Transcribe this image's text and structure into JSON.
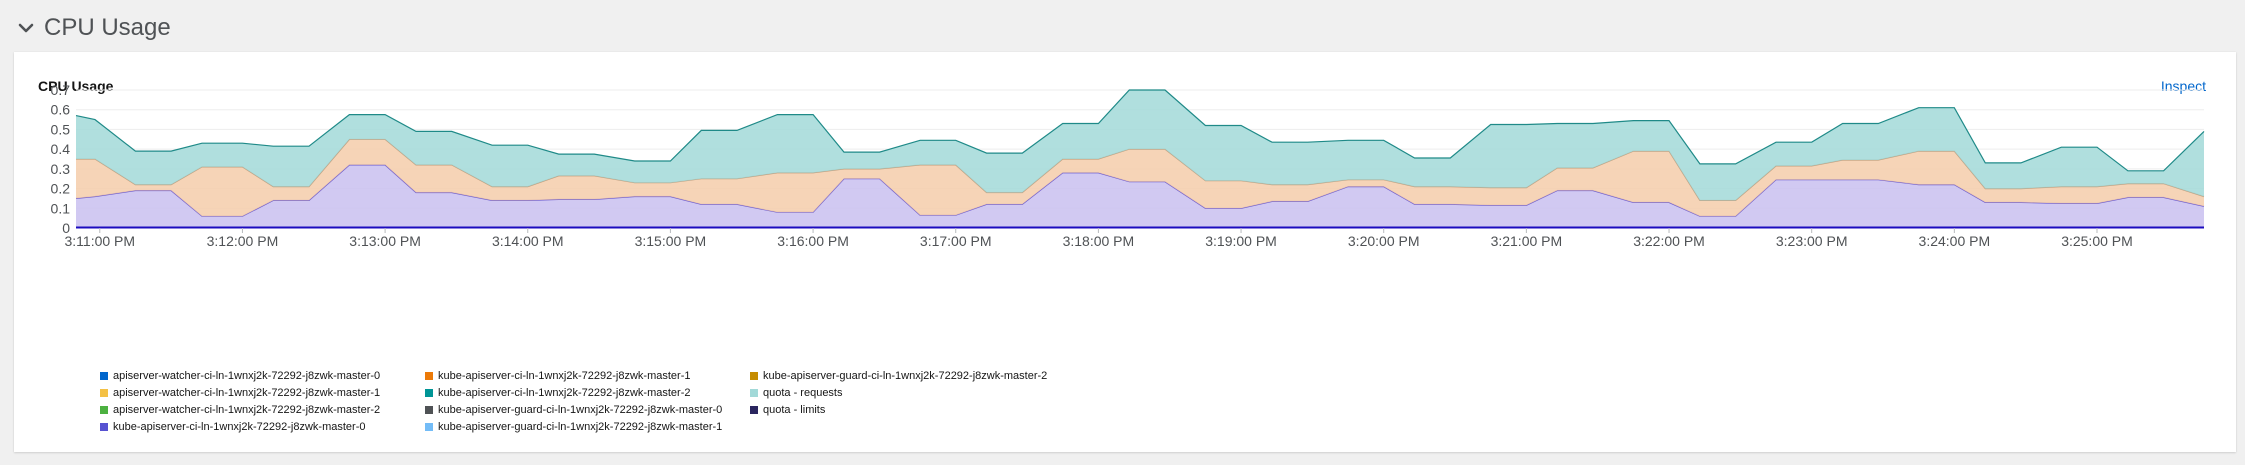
{
  "section": {
    "title": "CPU Usage",
    "icon": "chevron-down-icon"
  },
  "card": {
    "title": "CPU Usage",
    "inspect_label": "Inspect"
  },
  "colors": {
    "link": "#0066cc",
    "line": "#1f8a88",
    "requests_fill": "#a2d9d8",
    "master1_fill": "#f4ccaa",
    "master0_fill": "#c9c0f0",
    "master0_line": "#6b5bcf",
    "limits_line": "#1c0cbf"
  },
  "legend": [
    {
      "label": "apiserver-watcher-ci-ln-1wnxj2k-72292-j8zwk-master-0",
      "color": "#0066cc"
    },
    {
      "label": "kube-apiserver-ci-ln-1wnxj2k-72292-j8zwk-master-1",
      "color": "#ec7a08"
    },
    {
      "label": "kube-apiserver-guard-ci-ln-1wnxj2k-72292-j8zwk-master-2",
      "color": "#c58c00"
    },
    {
      "label": "apiserver-watcher-ci-ln-1wnxj2k-72292-j8zwk-master-1",
      "color": "#f4c145"
    },
    {
      "label": "kube-apiserver-ci-ln-1wnxj2k-72292-j8zwk-master-2",
      "color": "#009596"
    },
    {
      "label": "quota - requests",
      "color": "#a2d9d8"
    },
    {
      "label": "apiserver-watcher-ci-ln-1wnxj2k-72292-j8zwk-master-2",
      "color": "#4cb140"
    },
    {
      "label": "kube-apiserver-guard-ci-ln-1wnxj2k-72292-j8zwk-master-0",
      "color": "#4f5255"
    },
    {
      "label": "quota - limits",
      "color": "#2a265f"
    },
    {
      "label": "kube-apiserver-ci-ln-1wnxj2k-72292-j8zwk-master-0",
      "color": "#5752d1"
    },
    {
      "label": "kube-apiserver-guard-ci-ln-1wnxj2k-72292-j8zwk-master-1",
      "color": "#73bcf7"
    }
  ],
  "chart_data": {
    "type": "area",
    "stacked": true,
    "title": "CPU Usage",
    "xlabel": "",
    "ylabel": "",
    "ylim": [
      0,
      0.7
    ],
    "yticks": [
      "0",
      "0.1",
      "0.2",
      "0.3",
      "0.4",
      "0.5",
      "0.6",
      "0.7"
    ],
    "xticks": [
      "3:11:00 PM",
      "3:12:00 PM",
      "3:13:00 PM",
      "3:14:00 PM",
      "3:15:00 PM",
      "3:16:00 PM",
      "3:17:00 PM",
      "3:18:00 PM",
      "3:19:00 PM",
      "3:20:00 PM",
      "3:21:00 PM",
      "3:22:00 PM",
      "3:23:00 PM",
      "3:24:00 PM",
      "3:25:00 PM"
    ],
    "x_range": [
      "3:10:50 PM",
      "3:25:45 PM"
    ],
    "x": [
      "3:10:50 PM",
      "3:10:58 PM",
      "3:11:15 PM",
      "3:11:30 PM",
      "3:11:43 PM",
      "3:12:00 PM",
      "3:12:13 PM",
      "3:12:28 PM",
      "3:12:45 PM",
      "3:13:00 PM",
      "3:13:13 PM",
      "3:13:28 PM",
      "3:13:45 PM",
      "3:14:00 PM",
      "3:14:13 PM",
      "3:14:28 PM",
      "3:14:45 PM",
      "3:15:00 PM",
      "3:15:13 PM",
      "3:15:28 PM",
      "3:15:45 PM",
      "3:16:00 PM",
      "3:16:13 PM",
      "3:16:28 PM",
      "3:16:45 PM",
      "3:17:00 PM",
      "3:17:13 PM",
      "3:17:28 PM",
      "3:17:45 PM",
      "3:18:00 PM",
      "3:18:13 PM",
      "3:18:28 PM",
      "3:18:45 PM",
      "3:19:00 PM",
      "3:19:13 PM",
      "3:19:28 PM",
      "3:19:45 PM",
      "3:20:00 PM",
      "3:20:13 PM",
      "3:20:28 PM",
      "3:20:45 PM",
      "3:21:00 PM",
      "3:21:13 PM",
      "3:21:28 PM",
      "3:21:45 PM",
      "3:22:00 PM",
      "3:22:13 PM",
      "3:22:28 PM",
      "3:22:45 PM",
      "3:23:00 PM",
      "3:23:13 PM",
      "3:23:28 PM",
      "3:23:45 PM",
      "3:24:00 PM",
      "3:24:13 PM",
      "3:24:28 PM",
      "3:24:45 PM",
      "3:25:00 PM",
      "3:25:13 PM",
      "3:25:28 PM",
      "3:25:45 PM"
    ],
    "series": [
      {
        "name": "kube-apiserver-ci-ln-1wnxj2k-72292-j8zwk-master-0",
        "values": [
          0.15,
          0.16,
          0.19,
          0.19,
          0.06,
          0.06,
          0.14,
          0.14,
          0.32,
          0.32,
          0.18,
          0.18,
          0.14,
          0.14,
          0.145,
          0.145,
          0.16,
          0.16,
          0.12,
          0.12,
          0.08,
          0.08,
          0.25,
          0.25,
          0.065,
          0.065,
          0.12,
          0.12,
          0.28,
          0.28,
          0.235,
          0.235,
          0.1,
          0.1,
          0.135,
          0.135,
          0.21,
          0.21,
          0.12,
          0.12,
          0.115,
          0.115,
          0.19,
          0.19,
          0.13,
          0.13,
          0.06,
          0.06,
          0.245,
          0.245,
          0.245,
          0.245,
          0.22,
          0.22,
          0.13,
          0.13,
          0.125,
          0.125,
          0.155,
          0.155,
          0.11
        ]
      },
      {
        "name": "kube-apiserver-ci-ln-1wnxj2k-72292-j8zwk-master-1",
        "values": [
          0.2,
          0.19,
          0.03,
          0.03,
          0.25,
          0.25,
          0.07,
          0.07,
          0.13,
          0.13,
          0.14,
          0.14,
          0.07,
          0.07,
          0.12,
          0.12,
          0.07,
          0.07,
          0.13,
          0.13,
          0.2,
          0.2,
          0.05,
          0.05,
          0.255,
          0.255,
          0.06,
          0.06,
          0.07,
          0.07,
          0.165,
          0.165,
          0.14,
          0.14,
          0.085,
          0.085,
          0.035,
          0.035,
          0.09,
          0.09,
          0.09,
          0.09,
          0.115,
          0.115,
          0.26,
          0.26,
          0.08,
          0.08,
          0.07,
          0.07,
          0.1,
          0.1,
          0.17,
          0.17,
          0.07,
          0.07,
          0.085,
          0.085,
          0.07,
          0.07,
          0.05
        ]
      },
      {
        "name": "quota - requests",
        "values": [
          0.22,
          0.2,
          0.17,
          0.17,
          0.12,
          0.12,
          0.205,
          0.205,
          0.125,
          0.125,
          0.17,
          0.17,
          0.21,
          0.21,
          0.11,
          0.11,
          0.11,
          0.11,
          0.245,
          0.245,
          0.295,
          0.295,
          0.085,
          0.085,
          0.125,
          0.125,
          0.2,
          0.2,
          0.18,
          0.18,
          0.3,
          0.3,
          0.28,
          0.28,
          0.215,
          0.215,
          0.2,
          0.2,
          0.145,
          0.145,
          0.32,
          0.32,
          0.225,
          0.225,
          0.155,
          0.155,
          0.185,
          0.185,
          0.12,
          0.12,
          0.185,
          0.185,
          0.22,
          0.22,
          0.13,
          0.13,
          0.2,
          0.2,
          0.065,
          0.065,
          0.33
        ]
      }
    ],
    "grid": true,
    "legend_position": "bottom"
  }
}
